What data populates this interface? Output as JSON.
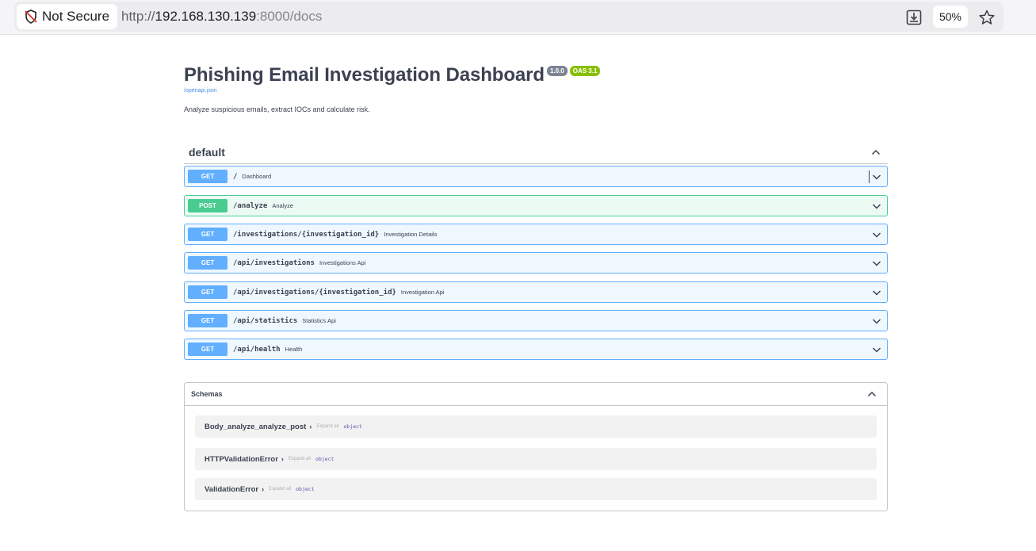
{
  "browser": {
    "security_label": "Not Secure",
    "url_scheme": "http://",
    "url_host": "192.168.130.139",
    "url_rest": ":8000/docs",
    "zoom": "50%"
  },
  "api": {
    "title": "Phishing Email Investigation Dashboard",
    "version": "1.0.0",
    "oas": "OAS 3.1",
    "spec_link": "/openapi.json",
    "description": "Analyze suspicious emails, extract IOCs and calculate risk."
  },
  "tag": {
    "name": "default"
  },
  "operations": [
    {
      "method": "GET",
      "path": "/",
      "summary": "Dashboard"
    },
    {
      "method": "POST",
      "path": "/analyze",
      "summary": "Analyze"
    },
    {
      "method": "GET",
      "path": "/investigations/{investigation_id}",
      "summary": "Investigation Details"
    },
    {
      "method": "GET",
      "path": "/api/investigations",
      "summary": "Investigations Api"
    },
    {
      "method": "GET",
      "path": "/api/investigations/{investigation_id}",
      "summary": "Investigation Api"
    },
    {
      "method": "GET",
      "path": "/api/statistics",
      "summary": "Statistics Api"
    },
    {
      "method": "GET",
      "path": "/api/health",
      "summary": "Health"
    }
  ],
  "schemas": {
    "title": "Schemas",
    "items": [
      {
        "name": "Body_analyze_analyze_post",
        "expand": "Expand all",
        "type": "object"
      },
      {
        "name": "HTTPValidationError",
        "expand": "Expand all",
        "type": "object"
      },
      {
        "name": "ValidationError",
        "expand": "Expand all",
        "type": "object"
      }
    ]
  }
}
